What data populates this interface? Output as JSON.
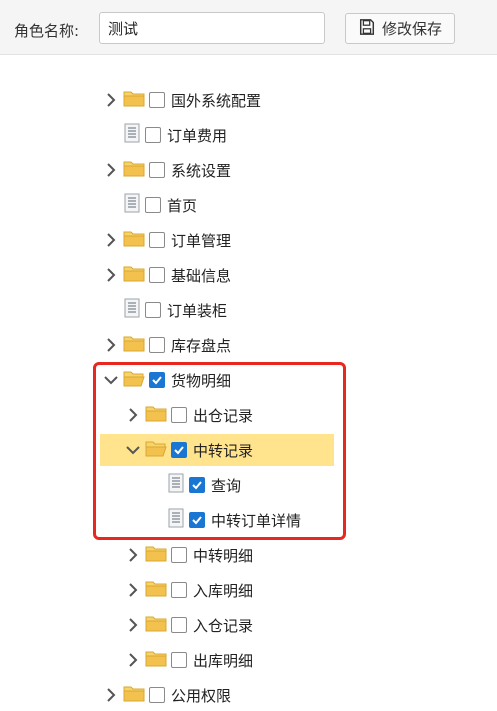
{
  "toolbar": {
    "role_label": "角色名称:",
    "role_value": "测试",
    "save_label": "修改保存",
    "save_icon": "save-icon"
  },
  "tree": [
    {
      "label": "国外系统配置",
      "type": "folder",
      "expanded": false,
      "checked": false,
      "level": 1
    },
    {
      "label": "订单费用",
      "type": "file",
      "checked": false,
      "level": 1
    },
    {
      "label": "系统设置",
      "type": "folder",
      "expanded": false,
      "checked": false,
      "level": 1
    },
    {
      "label": "首页",
      "type": "file",
      "checked": false,
      "level": 1
    },
    {
      "label": "订单管理",
      "type": "folder",
      "expanded": false,
      "checked": false,
      "level": 1
    },
    {
      "label": "基础信息",
      "type": "folder",
      "expanded": false,
      "checked": false,
      "level": 1
    },
    {
      "label": "订单装柜",
      "type": "file",
      "checked": false,
      "level": 1
    },
    {
      "label": "库存盘点",
      "type": "folder",
      "expanded": false,
      "checked": false,
      "level": 1
    },
    {
      "label": "货物明细",
      "type": "folder",
      "expanded": true,
      "checked": true,
      "level": 1
    },
    {
      "label": "出仓记录",
      "type": "folder",
      "expanded": false,
      "checked": false,
      "level": 2
    },
    {
      "label": "中转记录",
      "type": "folder",
      "expanded": true,
      "checked": true,
      "level": 2,
      "selected": true
    },
    {
      "label": "查询",
      "type": "file",
      "checked": true,
      "level": 3
    },
    {
      "label": "中转订单详情",
      "type": "file",
      "checked": true,
      "level": 3
    },
    {
      "label": "中转明细",
      "type": "folder",
      "expanded": false,
      "checked": false,
      "level": 2
    },
    {
      "label": "入库明细",
      "type": "folder",
      "expanded": false,
      "checked": false,
      "level": 2
    },
    {
      "label": "入仓记录",
      "type": "folder",
      "expanded": false,
      "checked": false,
      "level": 2
    },
    {
      "label": "出库明细",
      "type": "folder",
      "expanded": false,
      "checked": false,
      "level": 2
    },
    {
      "label": "公用权限",
      "type": "folder",
      "expanded": false,
      "checked": false,
      "level": 1
    }
  ],
  "colors": {
    "checkbox_checked": "#1976d2",
    "selected_row": "#ffe48d",
    "annotation_border": "#e8281f",
    "folder": "#f2c14e"
  }
}
